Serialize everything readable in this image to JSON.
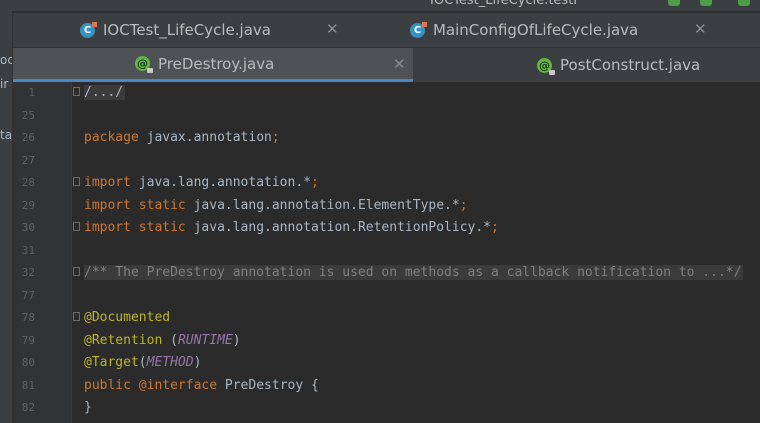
{
  "top": {
    "breadcrumb": "IOCTest_LifeCycle.testI"
  },
  "left_panel": {
    "fragments": [
      "oc",
      "ir",
      "ta"
    ]
  },
  "tabs_row1": [
    {
      "label": "IOCTest_LifeCycle.java",
      "icon": "java-class-icon"
    },
    {
      "label": "MainConfigOfLifeCycle.java",
      "icon": "java-class-icon"
    }
  ],
  "tabs_row2": [
    {
      "label": "PreDestroy.java",
      "icon": "annotation-icon",
      "active": true
    },
    {
      "label": "PostConstruct.java",
      "icon": "annotation-icon"
    }
  ],
  "tab_icons": {
    "class": "C",
    "annotation": "@"
  },
  "close_glyph": "✕",
  "editor": {
    "lines": [
      {
        "n": "1",
        "tokens": [
          "/.../"
        ]
      },
      {
        "n": "25",
        "tokens": []
      },
      {
        "n": "26",
        "tokens": [
          "package",
          " javax.annotation",
          ";"
        ]
      },
      {
        "n": "27",
        "tokens": []
      },
      {
        "n": "28",
        "tokens": [
          "import",
          " java.lang.annotation.*",
          ";"
        ]
      },
      {
        "n": "29",
        "tokens": [
          "import",
          " ",
          "static",
          " java.lang.annotation.ElementType.*",
          ";"
        ]
      },
      {
        "n": "30",
        "tokens": [
          "import",
          " ",
          "static",
          " java.lang.annotation.RetentionPolicy.*",
          ";"
        ]
      },
      {
        "n": "31",
        "tokens": []
      },
      {
        "n": "32",
        "tokens": [
          "/** The PreDestroy annotation is used on methods as a callback notification to ...*/"
        ]
      },
      {
        "n": "77",
        "tokens": []
      },
      {
        "n": "78",
        "tokens": [
          "@Documented"
        ]
      },
      {
        "n": "79",
        "tokens": [
          "@Retention",
          " (",
          "RUNTIME",
          ")"
        ]
      },
      {
        "n": "80",
        "tokens": [
          "@Target",
          "(",
          "METHOD",
          ")"
        ]
      },
      {
        "n": "81",
        "tokens": [
          "public",
          " ",
          "@interface",
          " PreDestroy {"
        ]
      },
      {
        "n": "82",
        "tokens": [
          "}"
        ]
      }
    ]
  },
  "colors": {
    "keyword": "#cc7832",
    "annotation": "#bbb529",
    "constant": "#9876aa",
    "comment": "#808080",
    "text": "#a9b7c6",
    "background": "#2b2b2b"
  }
}
